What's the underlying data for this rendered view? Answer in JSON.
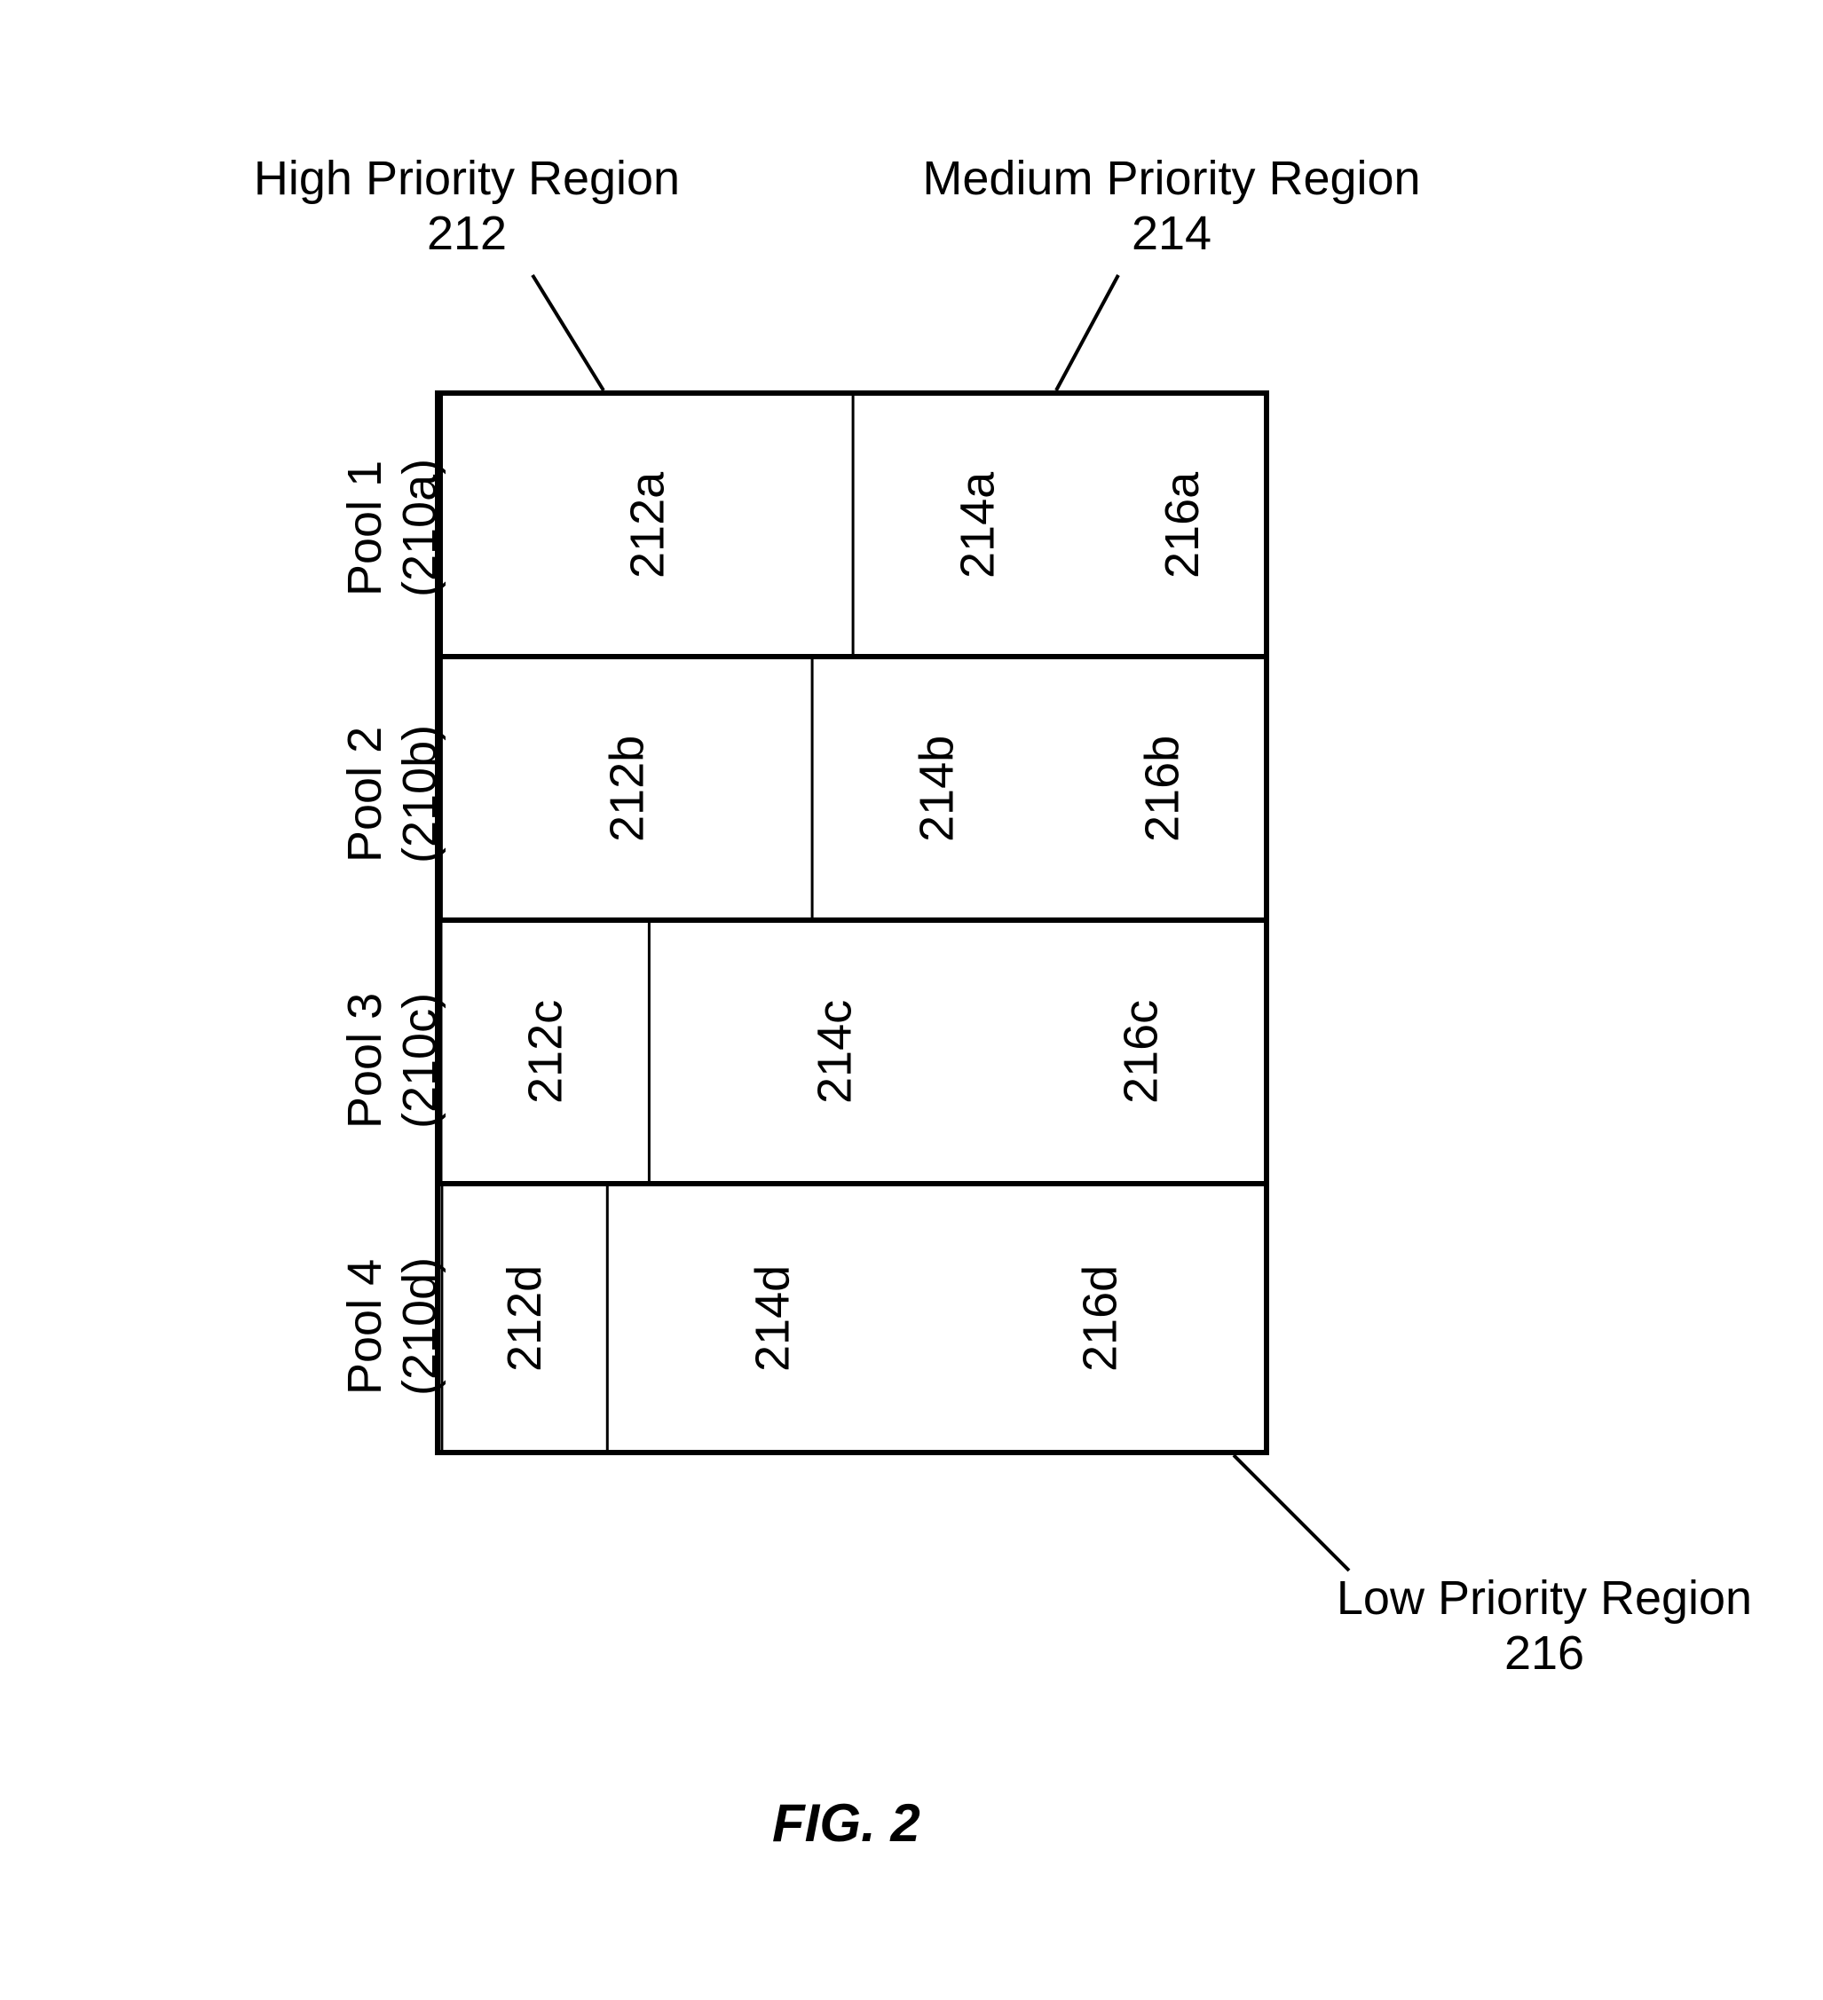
{
  "labels": {
    "high": {
      "line1": "High Priority Region",
      "line2": "212"
    },
    "medium": {
      "line1": "Medium Priority Region",
      "line2": "214"
    },
    "low": {
      "line1": "Low Priority Region",
      "line2": "216"
    }
  },
  "rows": [
    {
      "label": "Pool 1 (210a)",
      "cells": [
        {
          "text": "212a",
          "flex": 50
        },
        {
          "text": "214a",
          "flex": 30
        },
        {
          "text": "216a",
          "flex": 20
        }
      ]
    },
    {
      "label": "Pool 2 (210b)",
      "cells": [
        {
          "text": "212b",
          "flex": 45
        },
        {
          "text": "214b",
          "flex": 30
        },
        {
          "text": "216b",
          "flex": 25
        }
      ]
    },
    {
      "label": "Pool 3 (210c)",
      "cells": [
        {
          "text": "212c",
          "flex": 25
        },
        {
          "text": "214c",
          "flex": 45
        },
        {
          "text": "216c",
          "flex": 30
        }
      ]
    },
    {
      "label": "Pool 4 (210d)",
      "cells": [
        {
          "text": "212d",
          "flex": 20
        },
        {
          "text": "214d",
          "flex": 40
        },
        {
          "text": "216d",
          "flex": 40
        }
      ]
    }
  ],
  "caption": "FIG. 2"
}
